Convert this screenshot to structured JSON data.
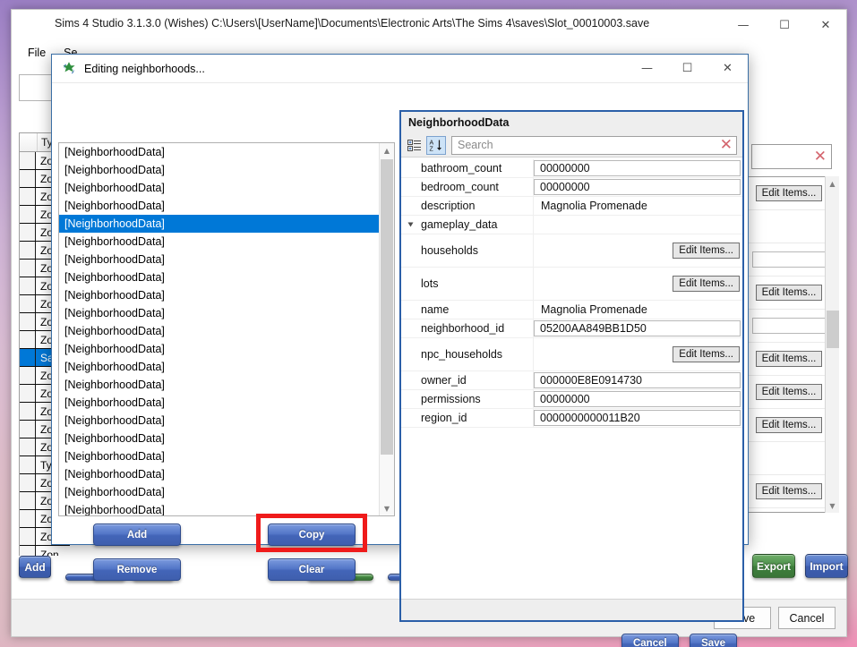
{
  "desktop": {
    "wallpaper_top_color": "#9b7fc4",
    "wallpaper_bottom_color": "#ef8fb6"
  },
  "main_window": {
    "title": "Sims 4 Studio 3.1.3.0 (Wishes)  C:\\Users\\[UserName]\\Documents\\Electronic Arts\\The Sims 4\\saves\\Slot_00010003.save",
    "window_controls": {
      "minimize": "—",
      "maximize": "☐",
      "close": "✕"
    },
    "menu": [
      {
        "label": "File"
      },
      {
        "label": "Se"
      }
    ],
    "table": {
      "header": "Typ",
      "rows": [
        {
          "type": "Zon",
          "selected": false
        },
        {
          "type": "Zon",
          "selected": false
        },
        {
          "type": "Zon",
          "selected": false
        },
        {
          "type": "Zon",
          "selected": false
        },
        {
          "type": "Zon",
          "selected": false
        },
        {
          "type": "Zon",
          "selected": false
        },
        {
          "type": "Zon",
          "selected": false
        },
        {
          "type": "Zon",
          "selected": false
        },
        {
          "type": "Zon",
          "selected": false
        },
        {
          "type": "Zon",
          "selected": false
        },
        {
          "type": "Zon",
          "selected": false
        },
        {
          "type": "Save",
          "selected": true
        },
        {
          "type": "Zon",
          "selected": false
        },
        {
          "type": "Zon",
          "selected": false
        },
        {
          "type": "Zon",
          "selected": false
        },
        {
          "type": "Zon",
          "selected": false
        },
        {
          "type": "Zon",
          "selected": false
        },
        {
          "type": "Typ",
          "selected": false
        },
        {
          "type": "Zon",
          "selected": false
        },
        {
          "type": "Zon",
          "selected": false
        },
        {
          "type": "Zon",
          "selected": false
        },
        {
          "type": "Zon",
          "selected": false
        },
        {
          "type": "Zon",
          "selected": false
        }
      ]
    },
    "right_panel": {
      "edit_items_label": "Edit Items...",
      "rows": [
        {
          "kind": "button"
        },
        {
          "kind": "empty"
        },
        {
          "kind": "value"
        },
        {
          "kind": "button"
        },
        {
          "kind": "value"
        },
        {
          "kind": "button"
        },
        {
          "kind": "button"
        },
        {
          "kind": "button"
        },
        {
          "kind": "empty"
        },
        {
          "kind": "button"
        }
      ]
    },
    "bottom_buttons": {
      "add_label": "Add",
      "export_label": "Export",
      "import_label": "Import"
    },
    "footer_buttons": {
      "save_label": "Save",
      "cancel_label": "Cancel"
    }
  },
  "dialog": {
    "title": "Editing neighborhoods...",
    "icon_name": "sims4studio-logo-icon",
    "window_controls": {
      "minimize": "—",
      "maximize": "☐",
      "close": "✕"
    },
    "list": {
      "items": [
        {
          "label": "[NeighborhoodData]",
          "selected": false
        },
        {
          "label": "[NeighborhoodData]",
          "selected": false
        },
        {
          "label": "[NeighborhoodData]",
          "selected": false
        },
        {
          "label": "[NeighborhoodData]",
          "selected": false
        },
        {
          "label": "[NeighborhoodData]",
          "selected": true
        },
        {
          "label": "[NeighborhoodData]",
          "selected": false
        },
        {
          "label": "[NeighborhoodData]",
          "selected": false
        },
        {
          "label": "[NeighborhoodData]",
          "selected": false
        },
        {
          "label": "[NeighborhoodData]",
          "selected": false
        },
        {
          "label": "[NeighborhoodData]",
          "selected": false
        },
        {
          "label": "[NeighborhoodData]",
          "selected": false
        },
        {
          "label": "[NeighborhoodData]",
          "selected": false
        },
        {
          "label": "[NeighborhoodData]",
          "selected": false
        },
        {
          "label": "[NeighborhoodData]",
          "selected": false
        },
        {
          "label": "[NeighborhoodData]",
          "selected": false
        },
        {
          "label": "[NeighborhoodData]",
          "selected": false
        },
        {
          "label": "[NeighborhoodData]",
          "selected": false
        },
        {
          "label": "[NeighborhoodData]",
          "selected": false
        },
        {
          "label": "[NeighborhoodData]",
          "selected": false
        },
        {
          "label": "[NeighborhoodData]",
          "selected": false
        },
        {
          "label": "[NeighborhoodData]",
          "selected": false
        }
      ]
    },
    "actions": {
      "add_label": "Add",
      "remove_label": "Remove",
      "copy_label": "Copy",
      "clear_label": "Clear",
      "highlighted_action": "Copy",
      "highlight_color": "#ef1b1b"
    },
    "property_panel": {
      "header": "NeighborhoodData",
      "toolbar": {
        "categorized_icon": "categorized-view-icon",
        "alphabetical_icon": "alphabetical-sort-icon",
        "alphabetical_active": true,
        "search_placeholder": "Search",
        "search_value": "",
        "clear_icon": "clear-search-icon"
      },
      "edit_items_label": "Edit Items...",
      "rows": [
        {
          "name": "bathroom_count",
          "value": "00000000",
          "style": "boxed",
          "expandable": false,
          "tall": false
        },
        {
          "name": "bedroom_count",
          "value": "00000000",
          "style": "boxed",
          "expandable": false,
          "tall": false
        },
        {
          "name": "description",
          "value": "Magnolia Promenade",
          "style": "plain",
          "expandable": false,
          "tall": false
        },
        {
          "name": "gameplay_data",
          "value": "",
          "style": "plain",
          "expandable": true,
          "tall": false
        },
        {
          "name": "households",
          "value": "Edit Items...",
          "style": "button",
          "expandable": false,
          "tall": true
        },
        {
          "name": "lots",
          "value": "Edit Items...",
          "style": "button",
          "expandable": false,
          "tall": true
        },
        {
          "name": "name",
          "value": "Magnolia Promenade",
          "style": "plain",
          "expandable": false,
          "tall": false
        },
        {
          "name": "neighborhood_id",
          "value": "05200AA849BB1D50",
          "style": "boxed",
          "expandable": false,
          "tall": false
        },
        {
          "name": "npc_households",
          "value": "Edit Items...",
          "style": "button",
          "expandable": false,
          "tall": true
        },
        {
          "name": "owner_id",
          "value": "000000E8E0914730",
          "style": "boxed",
          "expandable": false,
          "tall": false
        },
        {
          "name": "permissions",
          "value": "00000000",
          "style": "boxed",
          "expandable": false,
          "tall": false
        },
        {
          "name": "region_id",
          "value": "0000000000011B20",
          "style": "boxed",
          "expandable": false,
          "tall": false
        }
      ]
    },
    "footer": {
      "cancel_label": "Cancel",
      "save_label": "Save"
    }
  }
}
